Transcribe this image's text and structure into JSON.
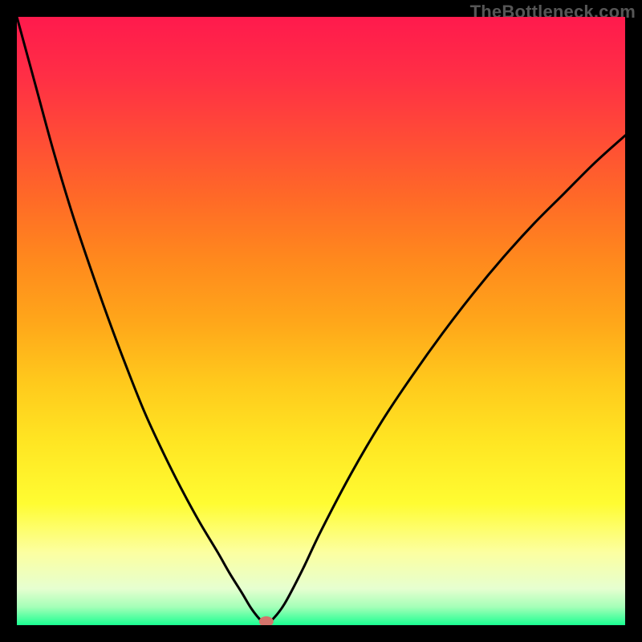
{
  "meta": {
    "watermark": "TheBottleneck.com"
  },
  "gradient": {
    "stops": [
      {
        "offset": 0.0,
        "color": "#ff1a4d"
      },
      {
        "offset": 0.1,
        "color": "#ff2f45"
      },
      {
        "offset": 0.2,
        "color": "#ff4c36"
      },
      {
        "offset": 0.3,
        "color": "#ff6a27"
      },
      {
        "offset": 0.4,
        "color": "#ff891d"
      },
      {
        "offset": 0.5,
        "color": "#ffa61a"
      },
      {
        "offset": 0.6,
        "color": "#ffc91c"
      },
      {
        "offset": 0.7,
        "color": "#ffe623"
      },
      {
        "offset": 0.8,
        "color": "#fffc32"
      },
      {
        "offset": 0.88,
        "color": "#fcffa0"
      },
      {
        "offset": 0.94,
        "color": "#e6ffd0"
      },
      {
        "offset": 0.97,
        "color": "#a5ffb8"
      },
      {
        "offset": 1.0,
        "color": "#1aff91"
      }
    ]
  },
  "chart_data": {
    "type": "line",
    "title": "",
    "xlabel": "",
    "ylabel": "",
    "xlim": [
      0,
      100
    ],
    "ylim": [
      0,
      100
    ],
    "x": [
      0,
      3,
      6,
      9,
      12,
      15,
      18,
      21,
      24,
      27,
      30,
      33,
      35,
      37,
      38.5,
      40,
      41,
      42,
      44,
      47,
      50,
      55,
      60,
      65,
      70,
      75,
      80,
      85,
      90,
      95,
      100
    ],
    "values": [
      100,
      89,
      78,
      68,
      59,
      50.5,
      42.5,
      35,
      28.5,
      22.5,
      17,
      12,
      8.5,
      5.3,
      2.8,
      0.9,
      0.2,
      0.9,
      3.5,
      9.2,
      15.5,
      25,
      33.5,
      41,
      48,
      54.5,
      60.5,
      66,
      71,
      76,
      80.5
    ],
    "marker": {
      "x": 41,
      "y": 0.6,
      "color": "#d4746b"
    },
    "note": "x and y are percentages of the plot area (0 at left/bottom, 100 at right/top). Values eyeballed from the image; the curve dips to ~0 near x=41 then rises."
  }
}
